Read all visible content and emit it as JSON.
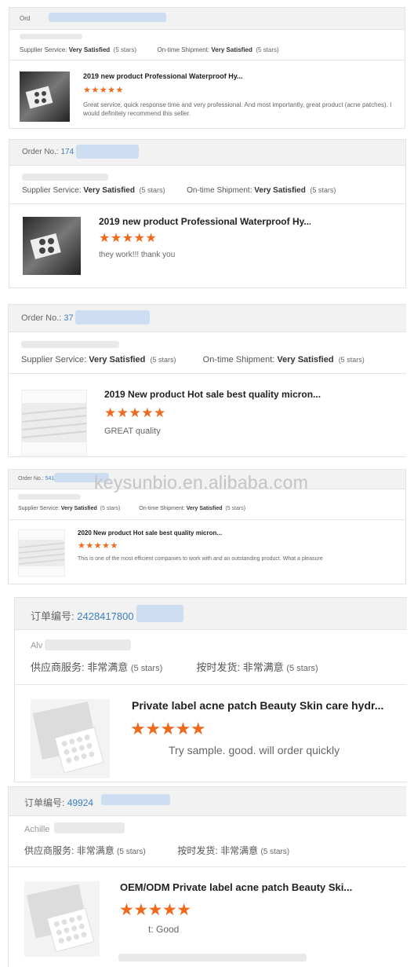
{
  "colors": {
    "star": "#ee6a1c",
    "order_link": "#3a7fc6",
    "header_bg": "#f2f2f2"
  },
  "watermark": "keysunbio.en.alibaba.com",
  "reviews": [
    {
      "order_label": "Ord",
      "order_number": "",
      "supplier_label": "Supplier Service:",
      "supplier_value": "Very Satisfied",
      "supplier_stars": "(5 stars)",
      "shipment_label": "On-time Shipment:",
      "shipment_value": "Very Satisfied",
      "shipment_stars": "(5 stars)",
      "product_title": "2019 new product Professional Waterproof Hy...",
      "stars": "★★★★★",
      "review_text": "Great service, quick response time and very professional. And most importantly, great product (acne patches). I would definitely recommend this seller.",
      "image_icon": "acne-patch-package-image"
    },
    {
      "order_label": "Order No.:",
      "order_number": "174",
      "supplier_label": "Supplier Service:",
      "supplier_value": "Very Satisfied",
      "supplier_stars": "(5 stars)",
      "shipment_label": "On-time Shipment:",
      "shipment_value": "Very Satisfied",
      "shipment_stars": "(5 stars)",
      "product_title": "2019 new product Professional Waterproof Hy...",
      "stars": "★★★★★",
      "review_text": "they work!!! thank you",
      "image_icon": "acne-patch-package-image"
    },
    {
      "order_label": "Order No.:",
      "order_number": "37",
      "supplier_label": "Supplier Service:",
      "supplier_value": "Very Satisfied",
      "supplier_stars": "(5 stars)",
      "shipment_label": "On-time Shipment:",
      "shipment_value": "Very Satisfied",
      "shipment_stars": "(5 stars)",
      "product_title": "2019 New product Hot sale best quality micron...",
      "stars": "★★★★★",
      "review_text": "GREAT quality",
      "image_icon": "microneedle-patch-image"
    },
    {
      "order_label": "Order No.:",
      "order_number": "541",
      "supplier_label": "Supplier Service:",
      "supplier_value": "Very Satisfied",
      "supplier_stars": "(5 stars)",
      "shipment_label": "On-time Shipment:",
      "shipment_value": "Very Satisfied",
      "shipment_stars": "(5 stars)",
      "product_title": "2020 New product Hot sale best quality micron...",
      "stars": "★★★★★",
      "review_text": "This is one of the most efficient companies to work with and an outstanding product. What a pleasure",
      "image_icon": "microneedle-patch-image"
    },
    {
      "order_label": "订单编号:",
      "order_number": "2428417800",
      "buyer_name": "Alv",
      "supplier_label": "供应商服务:",
      "supplier_value": "非常满意",
      "supplier_stars": "(5 stars)",
      "shipment_label": "按时发货:",
      "shipment_value": "非常满意",
      "shipment_stars": "(5 stars)",
      "product_title": "Private label acne patch Beauty Skin care hydr...",
      "stars": "★★★★★",
      "review_text": "Try sample. good. will order quickly",
      "image_icon": "acne-patch-sachet-image"
    },
    {
      "order_label": "订单编号:",
      "order_number": "49924",
      "buyer_name": "Achille",
      "supplier_label": "供应商服务:",
      "supplier_value": "非常满意",
      "supplier_stars": "(5 stars)",
      "shipment_label": "按时发货:",
      "shipment_value": "非常满意",
      "shipment_stars": "(5 stars)",
      "product_title": "OEM/ODM Private label acne patch Beauty Ski...",
      "stars": "★★★★★",
      "review_text": "t: Good",
      "image_icon": "acne-patch-sachet-image"
    }
  ]
}
